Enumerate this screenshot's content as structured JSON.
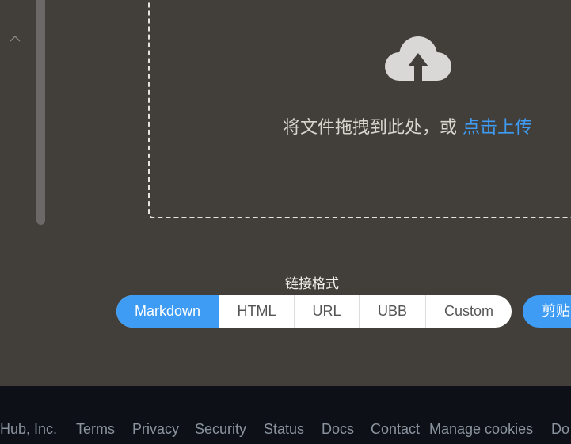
{
  "upload": {
    "drop_text": "将文件拖拽到此处，或",
    "click_upload": "点击上传",
    "icon": "cloud-upload-icon"
  },
  "format": {
    "title": "链接格式",
    "options": [
      "Markdown",
      "HTML",
      "URL",
      "UBB",
      "Custom"
    ],
    "active": "Markdown"
  },
  "clipboard": {
    "label": "剪贴"
  },
  "footer": {
    "links": [
      "tHub, Inc.",
      "Terms",
      "Privacy",
      "Security",
      "Status",
      "Docs",
      "Contact",
      "Manage cookies",
      "Do"
    ]
  },
  "colors": {
    "accent": "#3e9cf4",
    "background": "#423e39",
    "footer_bg": "#0d1117",
    "footer_text": "#8b949e"
  }
}
